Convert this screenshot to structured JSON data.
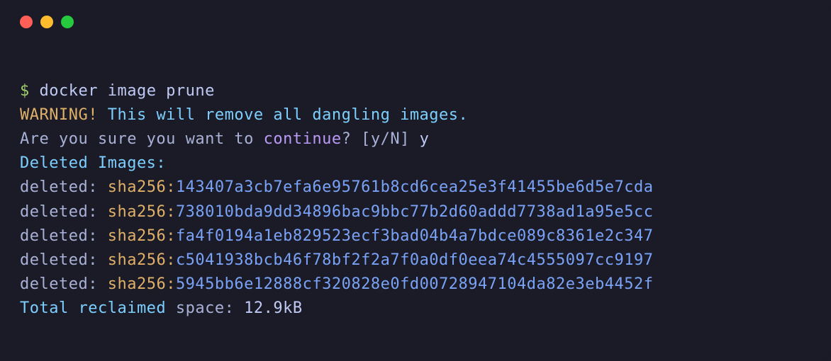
{
  "titlebar": {
    "close": "close",
    "minimize": "minimize",
    "maximize": "maximize"
  },
  "terminal": {
    "prompt": "$ ",
    "command": "docker image prune",
    "warning_label": "WARNING!",
    "warning_text": " This will remove all dangling images.",
    "confirm_prefix": "Are you sure you want to ",
    "confirm_word": "continue",
    "confirm_suffix": "? [y/N] ",
    "confirm_answer": "y",
    "deleted_header": "Deleted Images:",
    "deleted_label": "deleted: ",
    "sha_label": "sha256:",
    "hashes": [
      "143407a3cb7efa6e95761b8cd6cea25e3f41455be6d5e7cda",
      "738010bda9dd34896bac9bbc77b2d60addd7738ad1a95e5cc",
      "fa4f0194a1eb829523ecf3bad04b4a7bdce089c8361e2c347",
      "c5041938bcb46f78bf2f2a7f0a0df0eea74c4555097cc9197",
      "5945bb6e12888cf320828e0fd00728947104da82e3eb4452f"
    ],
    "reclaimed_prefix": "Total reclaimed ",
    "reclaimed_mid": "space: ",
    "reclaimed_value": "12.9kB"
  }
}
